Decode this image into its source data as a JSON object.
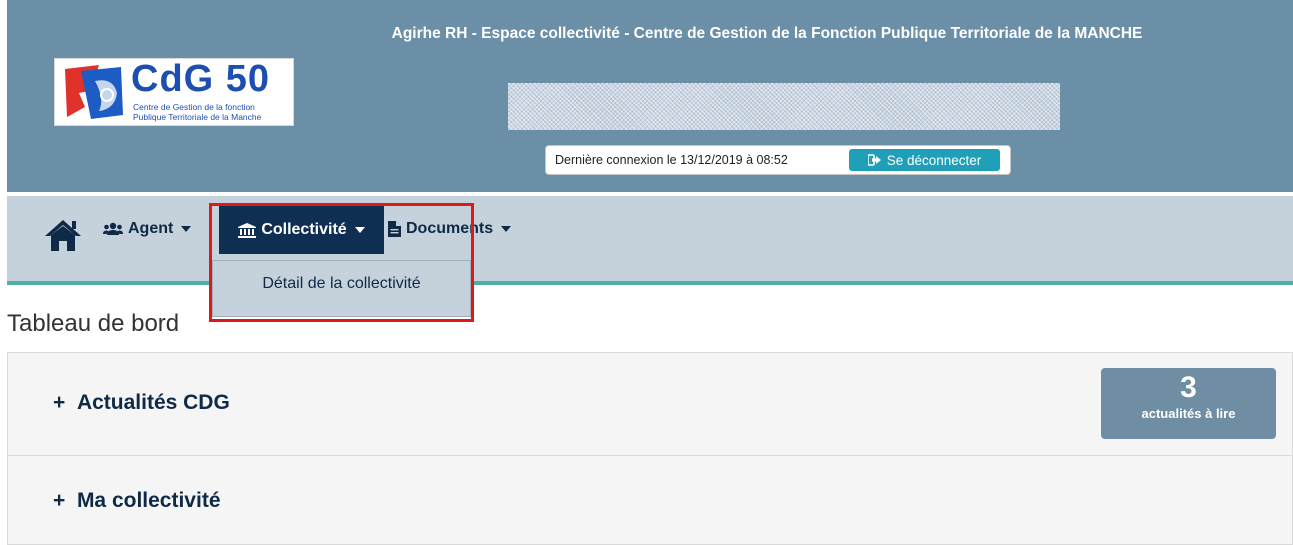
{
  "header": {
    "title": "Agirhe RH - Espace collectivité - Centre de Gestion de la Fonction Publique Territoriale de la MANCHE",
    "logo": {
      "text": "CdG 50",
      "subtitle_line1": "Centre de Gestion de la fonction",
      "subtitle_line2": "Publique Territoriale de la Manche"
    },
    "last_login": "Dernière connexion le 13/12/2019 à 08:52",
    "logout_label": "Se déconnecter",
    "colors": {
      "header_bg": "#6b8fa6",
      "button": "#1fa0b8"
    }
  },
  "nav": {
    "home_icon": "home-icon",
    "items": [
      {
        "label": "Agent",
        "icon": "users-icon"
      },
      {
        "label": "Collectivité",
        "icon": "bank-icon",
        "active": true
      },
      {
        "label": "Documents",
        "icon": "document-icon"
      }
    ],
    "dropdown": {
      "items": [
        "Détail de la collectivité"
      ]
    }
  },
  "main": {
    "page_title": "Tableau de bord",
    "panels": [
      {
        "title": "Actualités CDG",
        "badge_count": "3",
        "badge_label": "actualités à lire"
      },
      {
        "title": "Ma collectivité"
      }
    ]
  }
}
